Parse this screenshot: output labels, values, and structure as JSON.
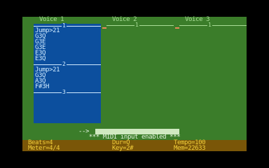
{
  "header": {
    "voice1": "Voice 1",
    "voice2": "Voice 2",
    "voice3": "Voice 3"
  },
  "voice1": {
    "sections": [
      {
        "marker": "1",
        "lines": [
          "Jump>21",
          "G3Q",
          "G3E",
          "G3E",
          "E3Q",
          "E3Q"
        ]
      },
      {
        "marker": "2",
        "lines": [
          "Jump>21",
          "G3Q",
          "A3Q",
          "F#3H"
        ]
      },
      {
        "marker": "3",
        "lines": []
      }
    ]
  },
  "voice2": {
    "marker": "1"
  },
  "voice3": {
    "marker": "1"
  },
  "input": {
    "prompt": "-->",
    "value": ""
  },
  "midi_message": "*** MIDI input enabled ***",
  "status": {
    "beats": "Beats=4",
    "dur": "Dur=Q",
    "tempo": "Tempo=100",
    "meter": "Meter=4/4",
    "key": "Key=2#",
    "mem": "Mem=22633"
  },
  "colors": {
    "background": "#3b7d2a",
    "voice1_panel": "#0c4f9e",
    "status_bar": "#7a5608",
    "status_text": "#f3cf3a"
  }
}
